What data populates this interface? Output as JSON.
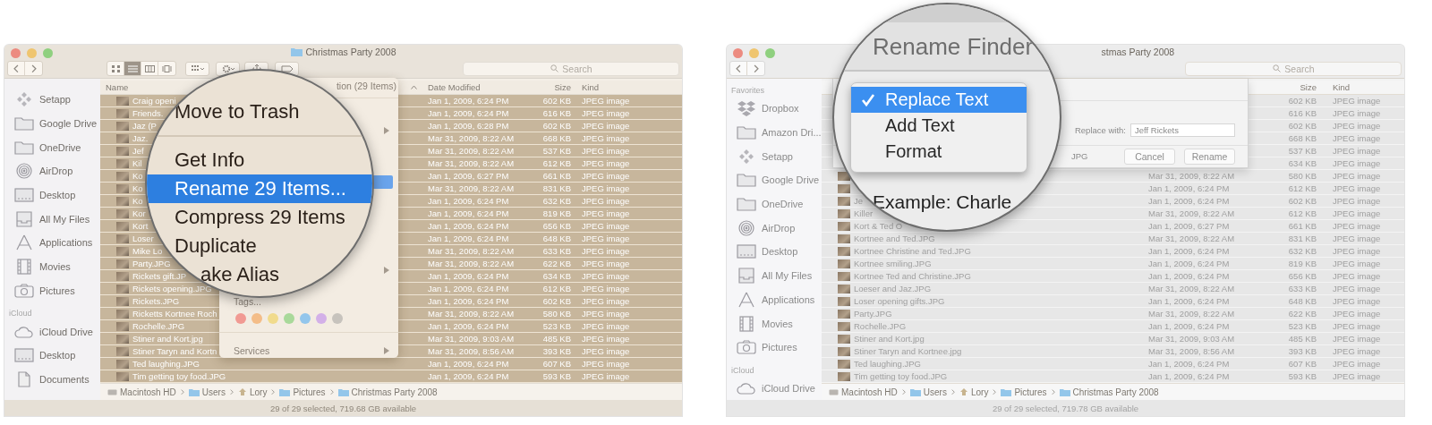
{
  "windows": [
    {
      "title": {
        "kind": "folder",
        "text": "Christmas Party 2008"
      },
      "toolbar": {
        "views": [
          {
            "kind": "icons",
            "selected": false
          },
          {
            "kind": "list",
            "selected": true
          },
          {
            "kind": "columns",
            "selected": false
          },
          {
            "kind": "gallery",
            "selected": false
          }
        ],
        "tools": [
          {
            "kind": "arrange"
          },
          {
            "kind": "action"
          },
          {
            "kind": "share"
          },
          {
            "kind": "tag"
          }
        ]
      },
      "search": {
        "placeholder": "Search"
      },
      "sidebar": [
        {
          "kind": "setapp",
          "label": "Setapp"
        },
        {
          "kind": "folder",
          "label": "Google Drive"
        },
        {
          "kind": "folder",
          "label": "OneDrive"
        },
        {
          "kind": "airdrop",
          "label": "AirDrop"
        },
        {
          "kind": "desktop",
          "label": "Desktop"
        },
        {
          "kind": "files",
          "label": "All My Files"
        },
        {
          "kind": "apps",
          "label": "Applications"
        },
        {
          "kind": "movies",
          "label": "Movies"
        },
        {
          "kind": "pictures",
          "label": "Pictures"
        },
        {
          "kind": "heading",
          "label": "iCloud"
        },
        {
          "kind": "cloud",
          "label": "iCloud Drive"
        },
        {
          "kind": "desktop",
          "label": "Desktop"
        },
        {
          "kind": "documents",
          "label": "Documents"
        }
      ],
      "header": {
        "name": "Name",
        "date": "Date Modified",
        "size": "Size",
        "type": "Kind"
      },
      "rows": [
        {
          "name": "Craig openi",
          "date": "Jan 1, 2009, 6:24 PM",
          "size": "602 KB",
          "type": "JPEG image",
          "selected": true
        },
        {
          "name": "Friends.",
          "date": "Jan 1, 2009, 6:24 PM",
          "size": "616 KB",
          "type": "JPEG image",
          "selected": true
        },
        {
          "name": "Jaz (P",
          "date": "Jan 1, 2009, 6:28 PM",
          "size": "602 KB",
          "type": "JPEG image",
          "selected": true
        },
        {
          "name": "Jaz.",
          "date": "Mar 31, 2009, 8:22 AM",
          "size": "668 KB",
          "type": "JPEG image",
          "selected": true
        },
        {
          "name": "Jef",
          "date": "Mar 31, 2009, 8:22 AM",
          "size": "537 KB",
          "type": "JPEG image",
          "selected": true
        },
        {
          "name": "Kil",
          "date": "Mar 31, 2009, 8:22 AM",
          "size": "612 KB",
          "type": "JPEG image",
          "selected": true
        },
        {
          "name": "Ko",
          "date": "Jan 1, 2009, 6:27 PM",
          "size": "661 KB",
          "type": "JPEG image",
          "selected": true
        },
        {
          "name": "Ko",
          "date": "Mar 31, 2009, 8:22 AM",
          "size": "831 KB",
          "type": "JPEG image",
          "selected": true
        },
        {
          "name": "Ko",
          "date": "Jan 1, 2009, 6:24 PM",
          "size": "632 KB",
          "type": "JPEG image",
          "selected": true
        },
        {
          "name": "Kor",
          "date": "Jan 1, 2009, 6:24 PM",
          "size": "819 KB",
          "type": "JPEG image",
          "selected": true
        },
        {
          "name": "Kort",
          "date": "Jan 1, 2009, 6:24 PM",
          "size": "656 KB",
          "type": "JPEG image",
          "selected": true
        },
        {
          "name": "Loser",
          "date": "Jan 1, 2009, 6:24 PM",
          "size": "648 KB",
          "type": "JPEG image",
          "selected": true
        },
        {
          "name": "Mike Lo",
          "date": "Mar 31, 2009, 8:22 AM",
          "size": "633 KB",
          "type": "JPEG image",
          "selected": true
        },
        {
          "name": "Party.JPG",
          "date": "Mar 31, 2009, 8:22 AM",
          "size": "622 KB",
          "type": "JPEG image",
          "selected": true
        },
        {
          "name": "Rickets gift.JP",
          "date": "Jan 1, 2009, 6:24 PM",
          "size": "634 KB",
          "type": "JPEG image",
          "selected": true
        },
        {
          "name": "Rickets opening.JPG",
          "date": "Jan 1, 2009, 6:24 PM",
          "size": "612 KB",
          "type": "JPEG image",
          "selected": true
        },
        {
          "name": "Rickets.JPG",
          "date": "Jan 1, 2009, 6:24 PM",
          "size": "602 KB",
          "type": "JPEG image",
          "selected": true
        },
        {
          "name": "Ricketts Kortnee Roch",
          "date": "Mar 31, 2009, 8:22 AM",
          "size": "580 KB",
          "type": "JPEG image",
          "selected": true
        },
        {
          "name": "Rochelle.JPG",
          "date": "Jan 1, 2009, 6:24 PM",
          "size": "523 KB",
          "type": "JPEG image",
          "selected": true
        },
        {
          "name": "Stiner and Kort.jpg",
          "date": "Mar 31, 2009, 9:03 AM",
          "size": "485 KB",
          "type": "JPEG image",
          "selected": true
        },
        {
          "name": "Stiner Taryn and Kortn",
          "date": "Mar 31, 2009, 8:56 AM",
          "size": "393 KB",
          "type": "JPEG image",
          "selected": true
        },
        {
          "name": "Ted laughing.JPG",
          "date": "Jan 1, 2009, 6:24 PM",
          "size": "607 KB",
          "type": "JPEG image",
          "selected": true
        },
        {
          "name": "Tim getting toy food.JPG",
          "date": "Jan 1, 2009, 6:24 PM",
          "size": "593 KB",
          "type": "JPEG image",
          "selected": true
        }
      ],
      "path": [
        {
          "kind": "drive",
          "label": "Macintosh HD"
        },
        {
          "kind": "folder",
          "label": "Users"
        },
        {
          "kind": "home",
          "label": "Lory"
        },
        {
          "kind": "folder",
          "label": "Pictures"
        },
        {
          "kind": "folder",
          "label": "Christmas Party 2008"
        }
      ],
      "status": "29 of 29 selected, 719.68 GB available",
      "context_menu": {
        "items": [
          {
            "kind": "partial",
            "label": "tion (29 Items)"
          },
          {
            "kind": "separator"
          },
          {
            "kind": "arrow"
          },
          {
            "kind": "highlight"
          },
          {
            "kind": "arrow"
          },
          {
            "kind": "label",
            "label": "Tags..."
          },
          {
            "kind": "tags",
            "dots": [
              {
                "color": "#f19a93"
              },
              {
                "color": "#f4bd88"
              },
              {
                "color": "#f1db8c"
              },
              {
                "color": "#a9d99a"
              },
              {
                "color": "#93c6ec"
              },
              {
                "color": "#d3b0e8"
              },
              {
                "color": "#c7c3bd"
              }
            ]
          },
          {
            "kind": "separator"
          },
          {
            "kind": "submenu",
            "label": "Services"
          }
        ]
      },
      "magnifier": {
        "kind": "menu",
        "items": [
          {
            "kind": "item",
            "label": "Move to Trash",
            "selected": false
          },
          {
            "kind": "separator"
          },
          {
            "kind": "item",
            "label": "Get Info",
            "selected": false
          },
          {
            "kind": "item",
            "label": "Rename 29 Items...",
            "selected": true
          },
          {
            "kind": "item",
            "label": "Compress 29 Items",
            "selected": false
          },
          {
            "kind": "item",
            "label": "Duplicate",
            "selected": false
          },
          {
            "kind": "item",
            "label": "ake Alias",
            "selected": false
          }
        ]
      }
    },
    {
      "title": {
        "kind": "plain",
        "text": "stmas Party 2008"
      },
      "search": {
        "placeholder": "Search"
      },
      "sidebar": [
        {
          "kind": "heading",
          "label": "Favorites"
        },
        {
          "kind": "dropbox",
          "label": "Dropbox"
        },
        {
          "kind": "folder",
          "label": "Amazon Dri..."
        },
        {
          "kind": "setapp",
          "label": "Setapp"
        },
        {
          "kind": "folder",
          "label": "Google Drive"
        },
        {
          "kind": "folder",
          "label": "OneDrive"
        },
        {
          "kind": "airdrop",
          "label": "AirDrop"
        },
        {
          "kind": "desktop",
          "label": "Desktop"
        },
        {
          "kind": "files",
          "label": "All My Files"
        },
        {
          "kind": "apps",
          "label": "Applications"
        },
        {
          "kind": "movies",
          "label": "Movies"
        },
        {
          "kind": "pictures",
          "label": "Pictures"
        },
        {
          "kind": "heading",
          "label": "iCloud"
        },
        {
          "kind": "cloud",
          "label": "iCloud Drive"
        }
      ],
      "header": {
        "size": "Size",
        "type": "Kind"
      },
      "rows": [
        {
          "size": "602 KB",
          "type": "JPEG image",
          "selected": false
        },
        {
          "size": "616 KB",
          "type": "JPEG image",
          "selected": false
        },
        {
          "size": "602 KB",
          "type": "JPEG image",
          "selected": false
        },
        {
          "size": "668 KB",
          "type": "JPEG image",
          "selected": false
        },
        {
          "size": "537 KB",
          "type": "JPEG image",
          "selected": false
        },
        {
          "size": "634 KB",
          "type": "JPEG image",
          "selected": false
        },
        {
          "date": "Mar 31, 2009, 8:22 AM",
          "size": "580 KB",
          "type": "JPEG image",
          "selected": false
        },
        {
          "date": "Jan 1, 2009, 6:24 PM",
          "size": "612 KB",
          "type": "JPEG image",
          "selected": false
        },
        {
          "name": "Je",
          "date": "Jan 1, 2009, 6:24 PM",
          "size": "602 KB",
          "type": "JPEG image",
          "selected": false
        },
        {
          "name": "Killer",
          "date": "Mar 31, 2009, 8:22 AM",
          "size": "612 KB",
          "type": "JPEG image",
          "selected": false
        },
        {
          "name": "Kort & Ted O",
          "date": "Jan 1, 2009, 6:27 PM",
          "size": "661 KB",
          "type": "JPEG image",
          "selected": false
        },
        {
          "name": "Kortnee and Ted.JPG",
          "date": "Mar 31, 2009, 8:22 AM",
          "size": "831 KB",
          "type": "JPEG image",
          "selected": false
        },
        {
          "name": "Kortnee Christine and Ted.JPG",
          "date": "Jan 1, 2009, 6:24 PM",
          "size": "632 KB",
          "type": "JPEG image",
          "selected": false
        },
        {
          "name": "Kortnee smiling.JPG",
          "date": "Jan 1, 2009, 6:24 PM",
          "size": "819 KB",
          "type": "JPEG image",
          "selected": false
        },
        {
          "name": "Kortnee Ted and Christine.JPG",
          "date": "Jan 1, 2009, 6:24 PM",
          "size": "656 KB",
          "type": "JPEG image",
          "selected": false
        },
        {
          "name": "Loeser and Jaz.JPG",
          "date": "Mar 31, 2009, 8:22 AM",
          "size": "633 KB",
          "type": "JPEG image",
          "selected": false
        },
        {
          "name": "Loser opening gifts.JPG",
          "date": "Jan 1, 2009, 6:24 PM",
          "size": "648 KB",
          "type": "JPEG image",
          "selected": false
        },
        {
          "name": "Party.JPG",
          "date": "Mar 31, 2009, 8:22 AM",
          "size": "622 KB",
          "type": "JPEG image",
          "selected": false
        },
        {
          "name": "Rochelle.JPG",
          "date": "Jan 1, 2009, 6:24 PM",
          "size": "523 KB",
          "type": "JPEG image",
          "selected": false
        },
        {
          "name": "Stiner and Kort.jpg",
          "date": "Mar 31, 2009, 9:03 AM",
          "size": "485 KB",
          "type": "JPEG image",
          "selected": false
        },
        {
          "name": "Stiner Taryn and Kortnee.jpg",
          "date": "Mar 31, 2009, 8:56 AM",
          "size": "393 KB",
          "type": "JPEG image",
          "selected": false
        },
        {
          "name": "Ted laughing.JPG",
          "date": "Jan 1, 2009, 6:24 PM",
          "size": "607 KB",
          "type": "JPEG image",
          "selected": false
        },
        {
          "name": "Tim getting toy food.JPG",
          "date": "Jan 1, 2009, 6:24 PM",
          "size": "593 KB",
          "type": "JPEG image",
          "selected": false
        }
      ],
      "path": [
        {
          "kind": "drive",
          "label": "Macintosh HD"
        },
        {
          "kind": "folder",
          "label": "Users"
        },
        {
          "kind": "home",
          "label": "Lory"
        },
        {
          "kind": "folder",
          "label": "Pictures"
        },
        {
          "kind": "folder",
          "label": "Christmas Party 2008"
        }
      ],
      "status": "29 of 29 selected, 719.78 GB available",
      "sheet": {
        "replace_label": "Replace with:",
        "replace_value": "Jeff Rickets",
        "file_ext": "JPG",
        "buttons": [
          "Cancel",
          "Rename"
        ]
      },
      "magnifier": {
        "kind": "rename",
        "title": "Rename Finder",
        "options": [
          {
            "label": "Replace Text",
            "selected": true
          },
          {
            "label": "Add Text",
            "selected": false
          },
          {
            "label": "Format",
            "selected": false
          }
        ],
        "example": "Example: Charle"
      }
    }
  ]
}
